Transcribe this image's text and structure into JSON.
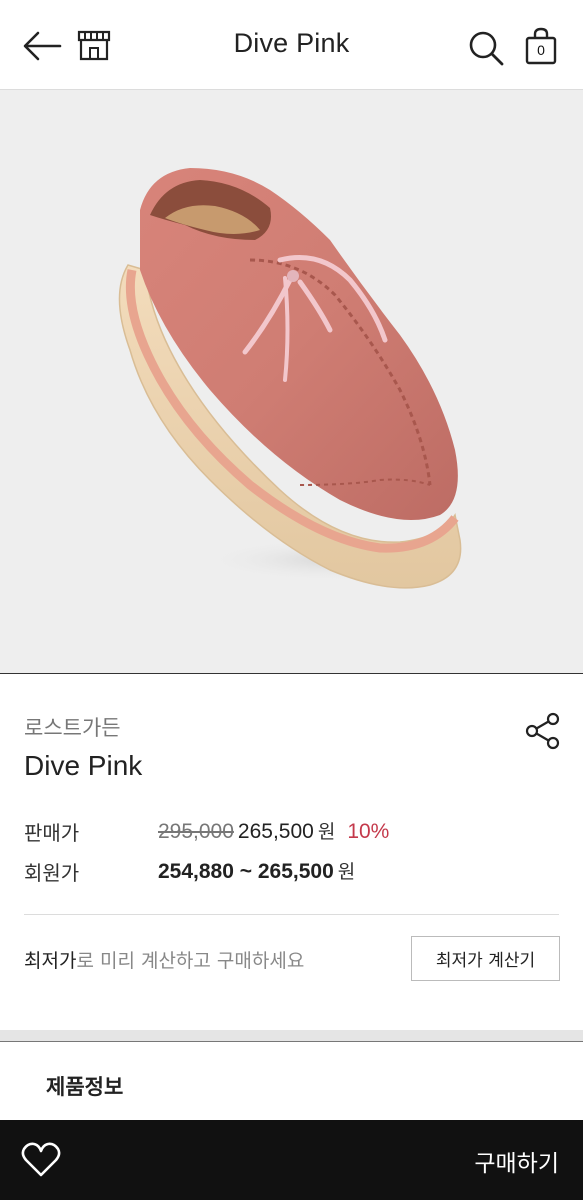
{
  "header": {
    "title": "Dive Pink",
    "cart_count": "0",
    "icons": [
      "back-arrow-icon",
      "store-icon",
      "search-icon",
      "shopping-bag-icon"
    ]
  },
  "product": {
    "image_alt_semantic": "shoe-image",
    "brand": "로스트가든",
    "name": "Dive Pink",
    "share_icon": "share-icon"
  },
  "price": {
    "sale_label": "판매가",
    "original": "295,000",
    "sale": "265,500",
    "currency": "원",
    "discount": "10%",
    "member_label": "회원가",
    "member_range": "254,880 ~ 265,500",
    "member_currency": "원"
  },
  "lowest": {
    "text_strong": "최저가",
    "text_rest": "로 미리 계산하고 구매하세요",
    "button_label": "최저가 계산기"
  },
  "tabs": {
    "info_label": "제품정보"
  },
  "bottom": {
    "buy_label": "구매하기",
    "heart_icon": "heart-icon"
  },
  "colors": {
    "discount": "#c4394b",
    "bottom_bar": "#111111",
    "hero_bg": "#eeeeee"
  }
}
